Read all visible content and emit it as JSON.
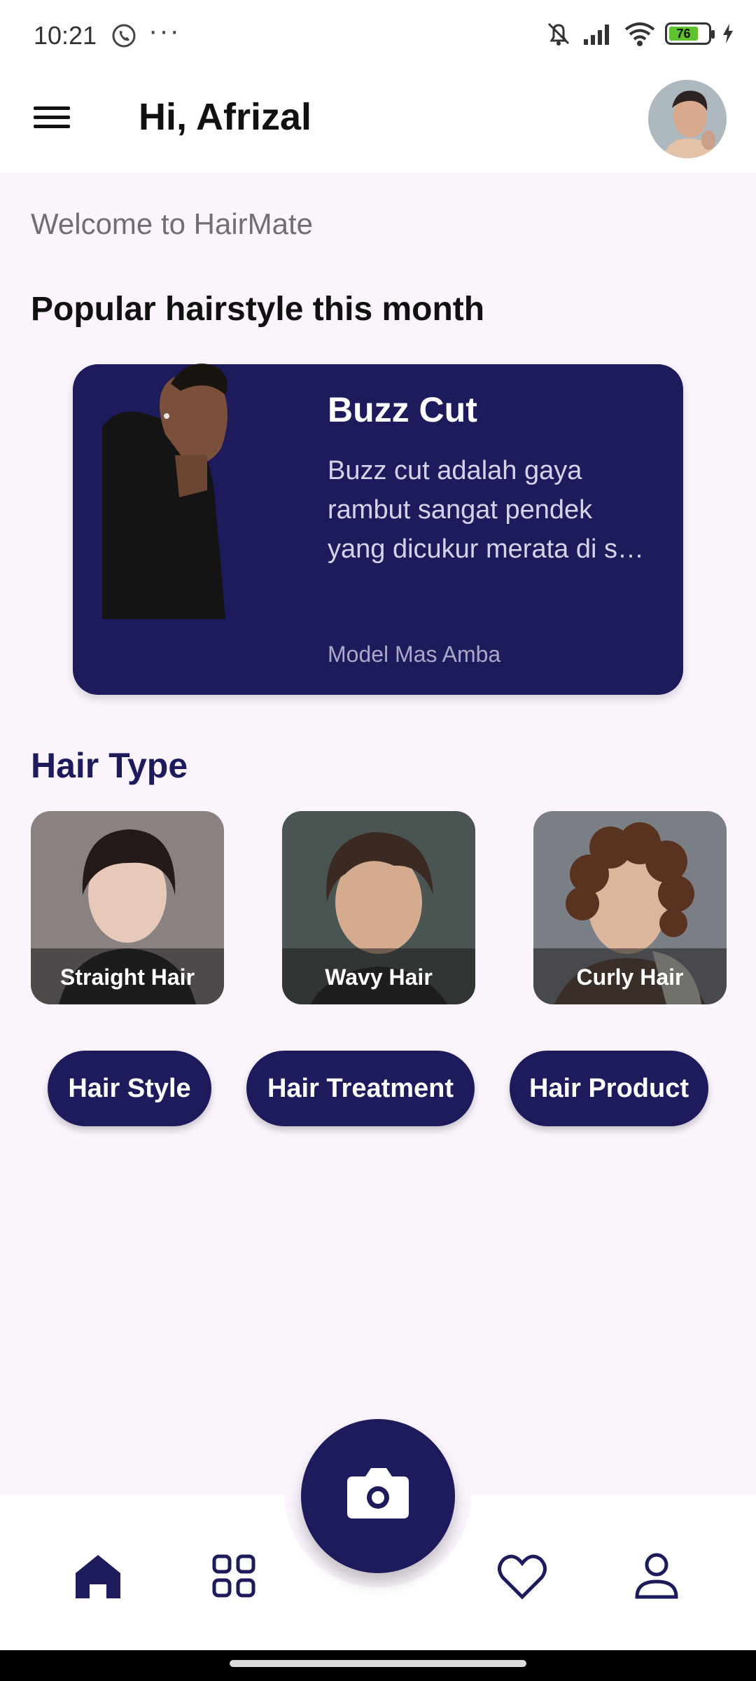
{
  "status_bar": {
    "time": "10:21",
    "dots": "···",
    "battery": "76"
  },
  "header": {
    "greeting": "Hi, Afrizal"
  },
  "welcome": "Welcome to HairMate",
  "popular": {
    "title": "Popular hairstyle this month",
    "card": {
      "name": "Buzz Cut",
      "description": "Buzz cut adalah gaya rambut sangat pendek yang dicukur merata di s…",
      "model": "Model Mas Amba"
    }
  },
  "hair_type": {
    "title": "Hair Type",
    "items": [
      {
        "label": "Straight Hair"
      },
      {
        "label": "Wavy Hair"
      },
      {
        "label": "Curly Hair"
      }
    ]
  },
  "pills": [
    {
      "label": "Hair Style"
    },
    {
      "label": "Hair Treatment"
    },
    {
      "label": "Hair Product"
    }
  ],
  "colors": {
    "primary": "#1d1b5c",
    "background": "#fcf4fd",
    "battery_fill": "#5fc32f"
  },
  "icons": {
    "menu": "hamburger-icon",
    "camera": "camera-icon",
    "nav": [
      "home-icon",
      "grid-icon",
      "heart-icon",
      "profile-icon"
    ]
  }
}
